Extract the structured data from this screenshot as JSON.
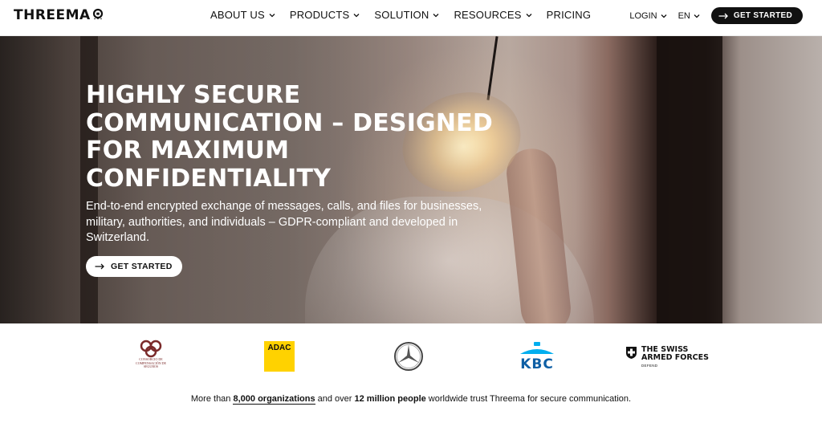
{
  "header": {
    "logo_text": "THREEMA",
    "nav": [
      {
        "label": "ABOUT US",
        "has_dropdown": true
      },
      {
        "label": "PRODUCTS",
        "has_dropdown": true
      },
      {
        "label": "SOLUTION",
        "has_dropdown": true
      },
      {
        "label": "RESOURCES",
        "has_dropdown": true
      },
      {
        "label": "PRICING",
        "has_dropdown": false
      }
    ],
    "login_label": "LOGIN",
    "language_label": "EN",
    "cta_label": "GET STARTED"
  },
  "hero": {
    "title": "HIGHLY SECURE COMMUNICATION – DESIGNED FOR MAXIMUM CONFIDENTIALITY",
    "subtitle": "End-to-end encrypted exchange of messages, calls, and files for businesses, military, authorities, and individuals – GDPR-compliant and developed in Switzerland.",
    "cta_label": "GET STARTED"
  },
  "logos": {
    "consorcio_caption": "CONSORCIO DE COMPENSACIÓN DE SEGUROS",
    "adac_text": "ADAC",
    "mercedes_icon": "mercedes-star-icon",
    "kbc_text": "KBC",
    "swiss_name_line1": "THE SWISS",
    "swiss_name_line2": "ARMED FORCES",
    "swiss_tagline": "DEFEND"
  },
  "trust": {
    "prefix": "More than ",
    "orgs": "8,000 organizations",
    "middle": " and over ",
    "people": "12 million people",
    "suffix": " worldwide trust Threema for secure communication."
  },
  "colors": {
    "dark": "#111111",
    "adac_yellow": "#ffd200",
    "kbc_blue": "#0e5fa5",
    "kbc_light_blue": "#00aeef",
    "consorcio_red": "#7a2a2a"
  }
}
